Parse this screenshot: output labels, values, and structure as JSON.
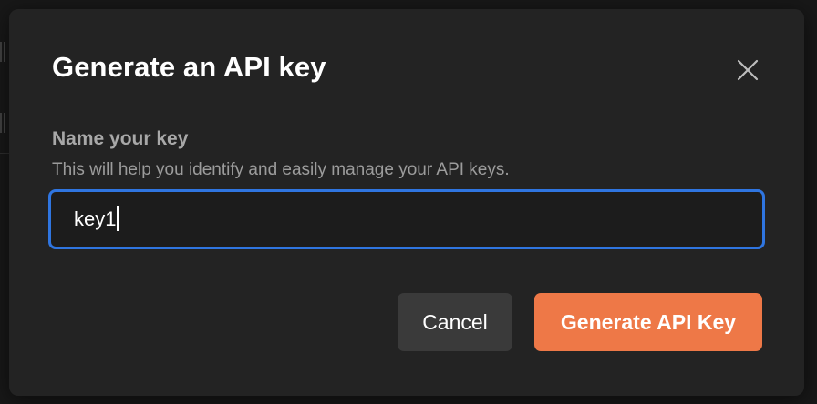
{
  "dialog": {
    "title": "Generate an API key",
    "close_icon": "close-icon",
    "field": {
      "label": "Name your key",
      "help": "This will help you identify and easily manage your API keys.",
      "value": "key1"
    },
    "buttons": {
      "cancel_label": "Cancel",
      "generate_label": "Generate API Key"
    }
  },
  "colors": {
    "accent": "#ee7847",
    "focus_ring": "#2f75e0",
    "dialog_bg": "#232323",
    "backdrop": "#181818"
  }
}
